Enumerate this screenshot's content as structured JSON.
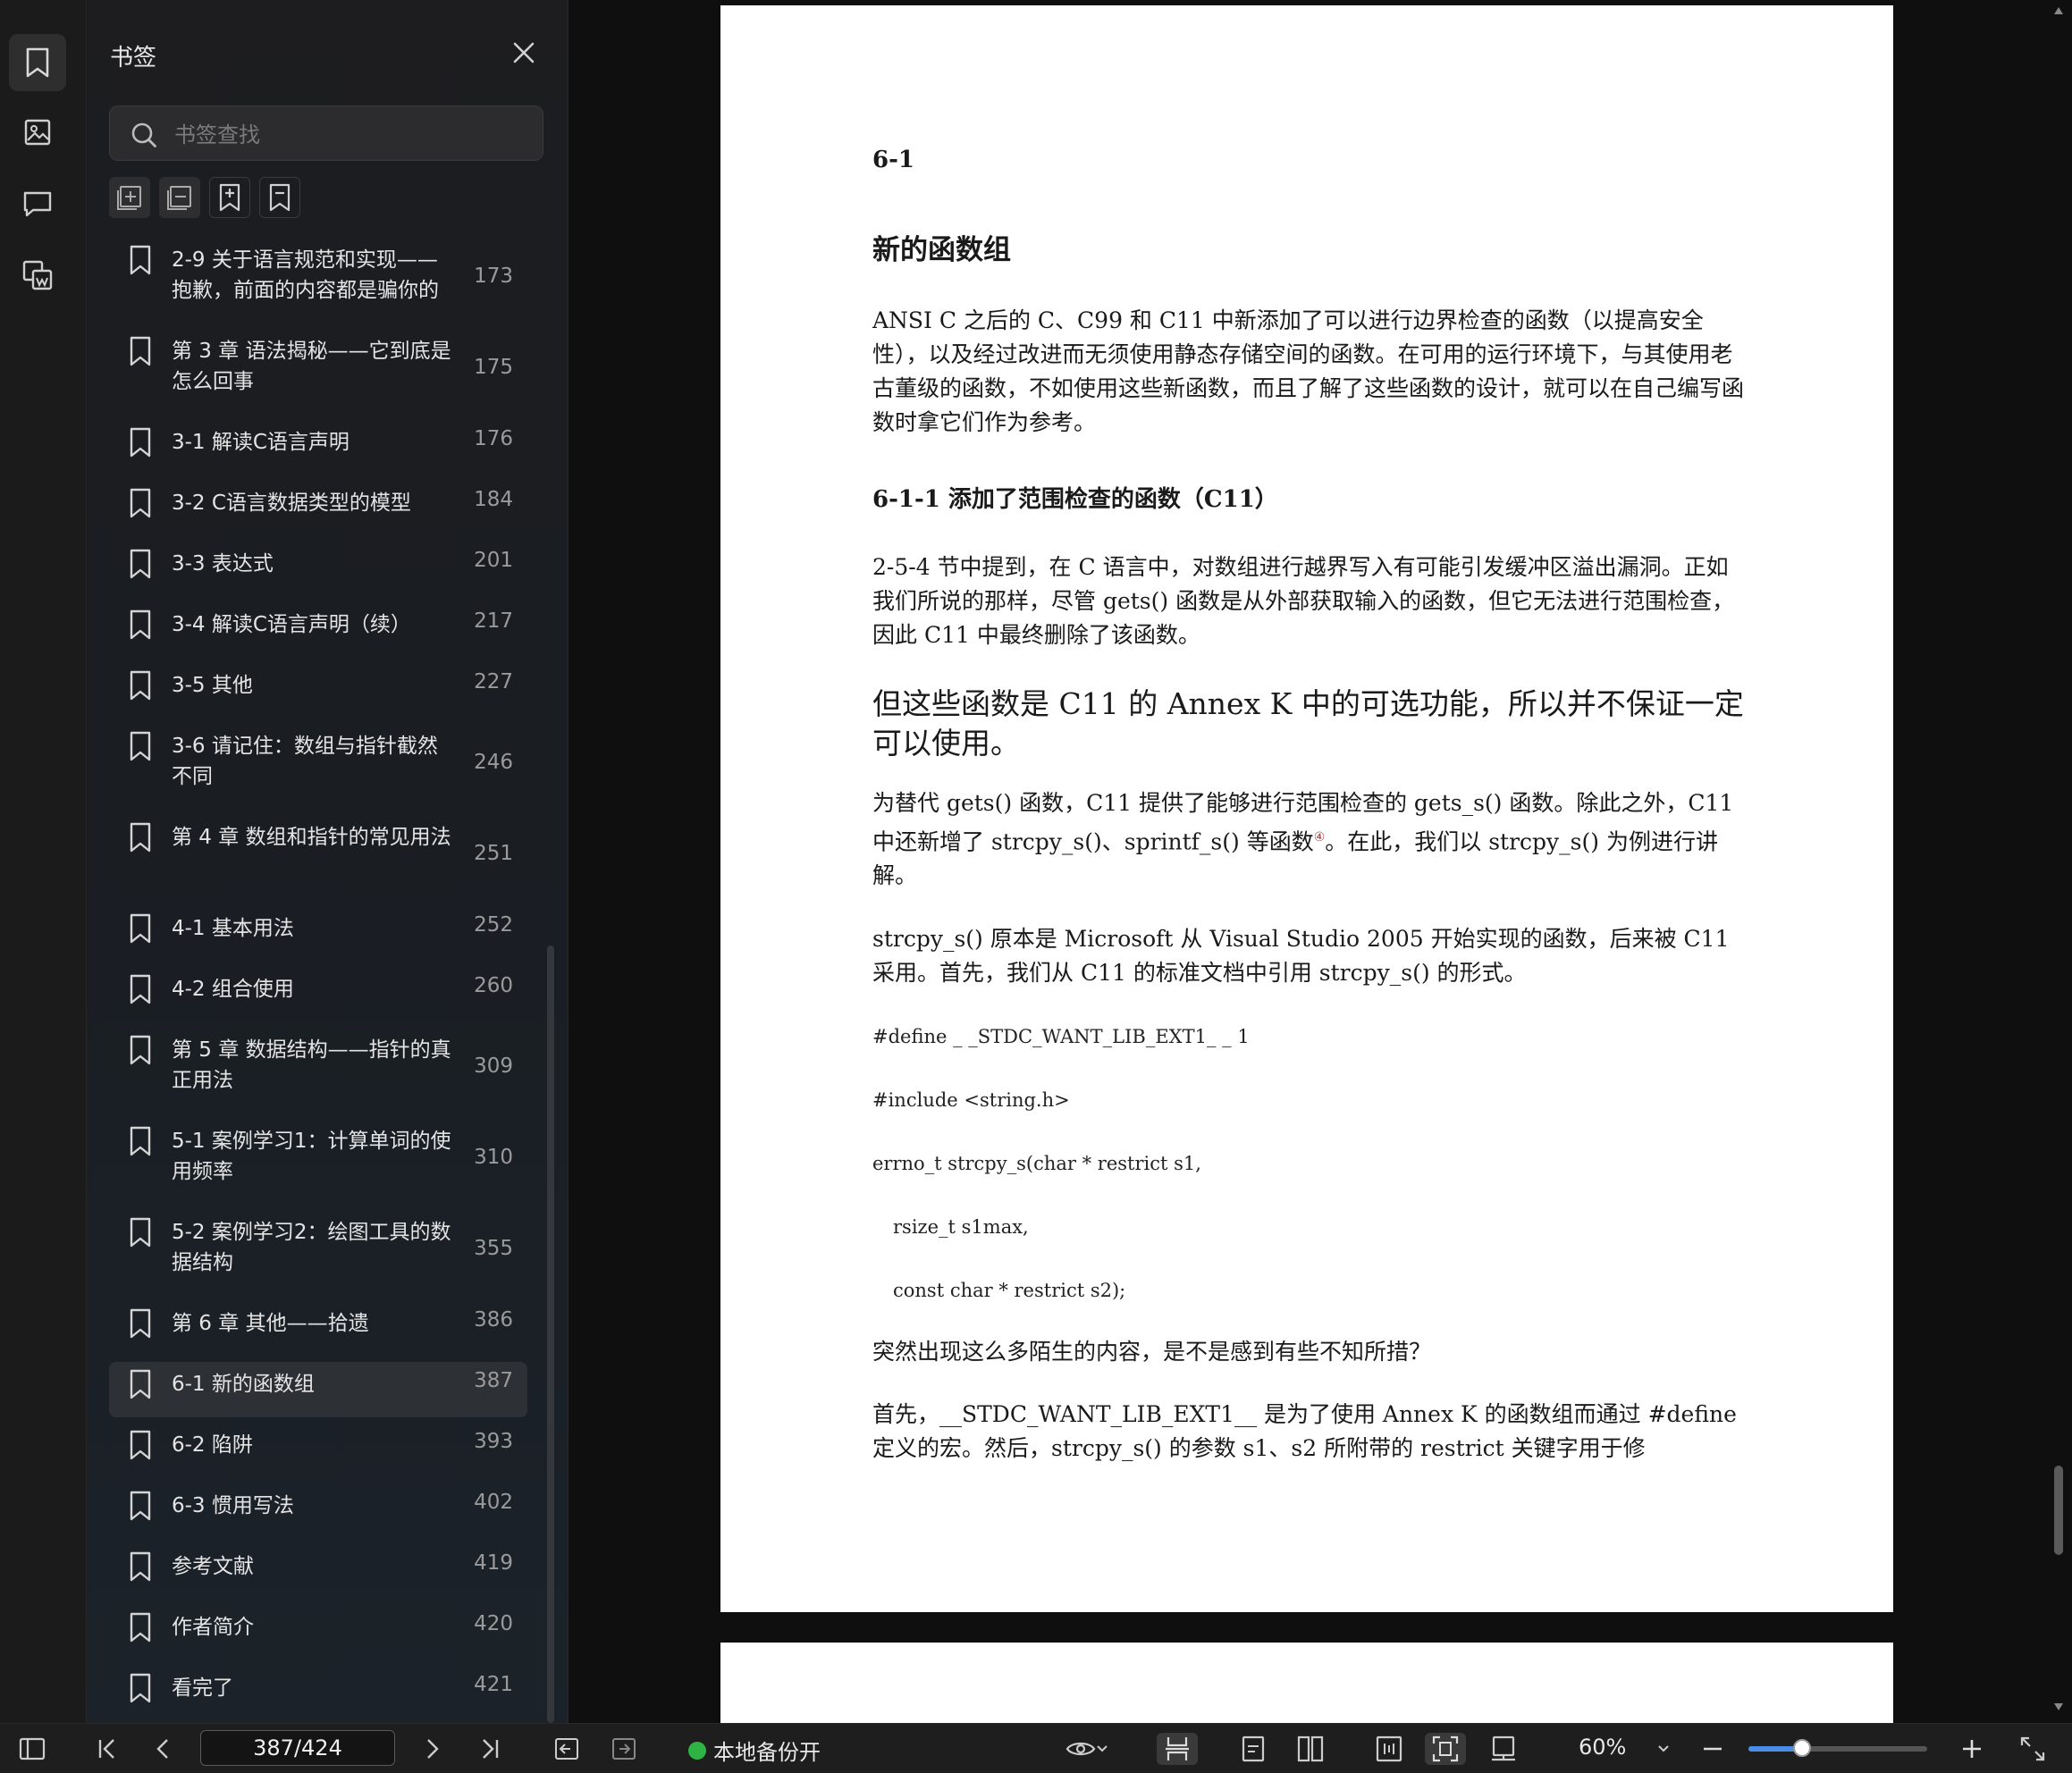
{
  "panel": {
    "title": "书签",
    "search_placeholder": "书签查找",
    "bookmarks": [
      {
        "label": "2-9 关于语言规范和实现——抱歉，前面的内容都是骗你的",
        "page": "173"
      },
      {
        "label": "第 3 章 语法揭秘——它到底是怎么回事",
        "page": "175"
      },
      {
        "label": "3-1 解读C语言声明",
        "page": "176"
      },
      {
        "label": "3-2 C语言数据类型的模型",
        "page": "184"
      },
      {
        "label": "3-3 表达式",
        "page": "201"
      },
      {
        "label": "3-4 解读C语言声明（续）",
        "page": "217"
      },
      {
        "label": "3-5 其他",
        "page": "227"
      },
      {
        "label": "3-6 请记住：数组与指针截然不同",
        "page": "246"
      },
      {
        "label": "第 4 章 数组和指针的常见用法",
        "page": "251"
      },
      {
        "label": "4-1 基本用法",
        "page": "252"
      },
      {
        "label": "4-2 组合使用",
        "page": "260"
      },
      {
        "label": "第 5 章 数据结构——指针的真正用法",
        "page": "309"
      },
      {
        "label": "5-1 案例学习1：计算单词的使用频率",
        "page": "310"
      },
      {
        "label": "5-2 案例学习2：绘图工具的数据结构",
        "page": "355"
      },
      {
        "label": "第 6 章 其他——拾遗",
        "page": "386"
      },
      {
        "label": "6-1 新的函数组",
        "page": "387"
      },
      {
        "label": "6-2 陷阱",
        "page": "393"
      },
      {
        "label": "6-3 惯用写法",
        "page": "402"
      },
      {
        "label": "参考文献",
        "page": "419"
      },
      {
        "label": "作者简介",
        "page": "420"
      },
      {
        "label": "看完了",
        "page": "421"
      }
    ]
  },
  "document": {
    "section_number": "6-1",
    "heading": "新的函数组",
    "para1": "ANSI C 之后的 C、C99 和 C11 中新添加了可以进行边界检查的函数（以提高安全性），以及经过改进而无须使用静态存储空间的函数。在可用的运行环境下，与其使用老古董级的函数，不如使用这些新函数，而且了解了这些函数的设计，就可以在自己编写函数时拿它们作为参考。",
    "subheading": "6-1-1 添加了范围检查的函数（C11）",
    "para2": "2-5-4 节中提到，在 C 语言中，对数组进行越界写入有可能引发缓冲区溢出漏洞。正如我们所说的那样，尽管 gets() 函数是从外部获取输入的函数，但它无法进行范围检查，因此 C11 中最终删除了该函数。",
    "big_text": "但这些函数是 C11 的 Annex K 中的可选功能，所以并不保证一定可以使用。",
    "para3a": "为替代 gets() 函数，C11 提供了能够进行范围检查的 gets_s() 函数。除此之外，C11 中还新增了 strcpy_s()、sprintf_s() 等函数",
    "footnote_mark": "④",
    "para3b": "。在此，我们以 strcpy_s() 为例进行讲解。",
    "para4": "strcpy_s() 原本是 Microsoft 从 Visual Studio 2005 开始实现的函数，后来被 C11 采用。首先，我们从 C11 的标准文档中引用 strcpy_s() 的形式。",
    "code": [
      "#define _ _STDC_WANT_LIB_EXT1_ _ 1",
      "#include <string.h>",
      "errno_t strcpy_s(char * restrict s1,",
      "rsize_t s1max,",
      "const char * restrict s2);"
    ],
    "para5": "突然出现这么多陌生的内容，是不是感到有些不知所措？",
    "para6": "首先，__STDC_WANT_LIB_EXT1__ 是为了使用 Annex K 的函数组而通过 #define 定义的宏。然后，strcpy_s() 的参数 s1、s2 所附带的 restrict 关键字用于修"
  },
  "statusbar": {
    "page_indicator": "387/424",
    "backup_label": "本地备份开",
    "zoom": "60%",
    "zoom_fraction": 0.3,
    "backup_color": "#2fb344"
  }
}
